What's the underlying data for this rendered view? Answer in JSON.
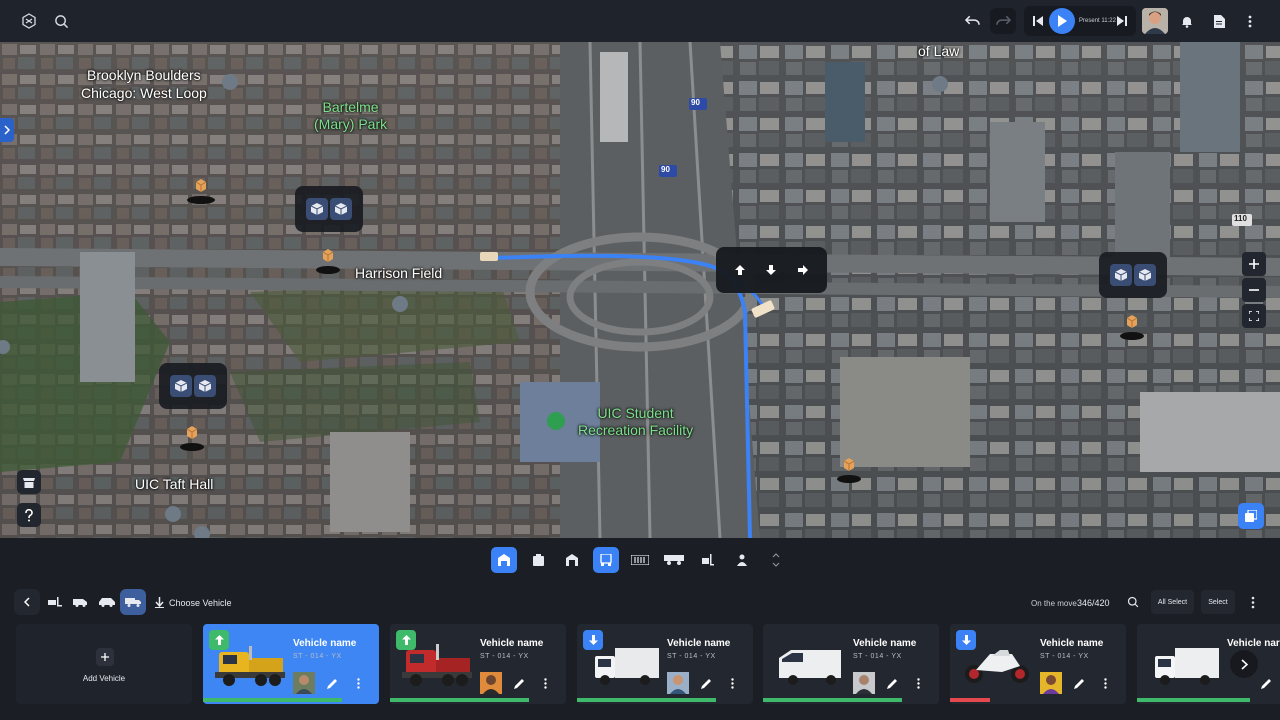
{
  "topbar": {
    "time_label": "Present 11:22",
    "icons": [
      "logo-icon",
      "search-icon",
      "undo-icon",
      "redo-icon",
      "skip-back-icon",
      "play-icon",
      "skip-forward-icon",
      "avatar",
      "bell-icon",
      "document-icon",
      "kebab-icon"
    ]
  },
  "map": {
    "labels": {
      "brooklyn": "Brooklyn Boulders",
      "chicago": "Chicago: West Loop",
      "bartelme": "Bartelme\n(Mary) Park",
      "harrison": "Harrison Field",
      "uic_student": "UIC Student\nRecreation Facility",
      "uic_taft": "UIC Taft Hall",
      "of_law": "of Law",
      "i90_a": "90",
      "i90_b": "90",
      "r110": "110"
    },
    "controls": [
      "zoom-in",
      "zoom-out",
      "fullscreen"
    ],
    "route_color": "#3b82f6"
  },
  "toolbar": {
    "tools": [
      "warehouse-icon",
      "box-icon",
      "garage-icon",
      "truck-front-icon",
      "barcode-icon",
      "trailer-icon",
      "forklift-icon",
      "person-icon",
      "sort-icon"
    ]
  },
  "bottombar": {
    "choose_vehicle": "Choose Vehicle",
    "on_the_move": "On the move",
    "count": "346/420",
    "all_select": "All Select",
    "select": "Select"
  },
  "add_vehicle": "Add Vehicle",
  "vehicles": [
    {
      "name": "Vehicle name",
      "code": "ST - 014 - YX",
      "direction": "up",
      "progress": 0.79,
      "progress_color": "#3fb96a"
    },
    {
      "name": "Vehicle name",
      "code": "ST - 014 - YX",
      "direction": "up",
      "progress": 0.79,
      "progress_color": "#3fb96a"
    },
    {
      "name": "Vehicle name",
      "code": "ST - 014 - YX",
      "direction": "down",
      "progress": 0.79,
      "progress_color": "#3fb96a"
    },
    {
      "name": "Vehicle name",
      "code": "ST - 014 - YX",
      "direction": "none",
      "progress": 0.79,
      "progress_color": "#3fb96a"
    },
    {
      "name": "Vehicle name",
      "code": "ST - 014 - YX",
      "direction": "down",
      "progress": 0.23,
      "progress_color": "#e5484d"
    },
    {
      "name": "Vehicle nar",
      "code": "",
      "direction": "none",
      "progress": 0.79,
      "progress_color": "#3fb96a"
    }
  ]
}
